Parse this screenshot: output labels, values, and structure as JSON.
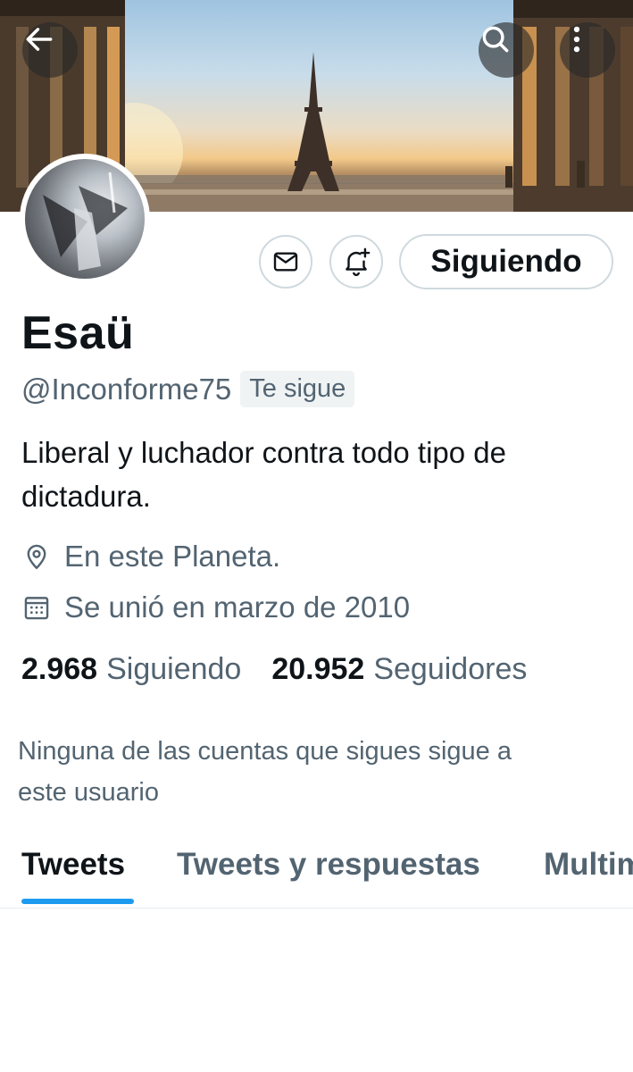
{
  "header": {
    "back_icon": "arrow-left-icon",
    "search_icon": "search-icon",
    "more_icon": "more-vertical-icon"
  },
  "profile": {
    "name": "Esaü",
    "handle": "@Inconforme75",
    "follows_you": "Te sigue",
    "bio_line1": "Liberal y luchador contra todo tipo de",
    "bio_line2": "dictadura.",
    "location": "En este Planeta.",
    "joined": "Se unió en marzo de 2010",
    "following_count": "2.968",
    "following_label": "Siguiendo",
    "followers_count": "20.952",
    "followers_label": "Seguidores",
    "mutual_line1": "Ninguna de las cuentas que sigues sigue a",
    "mutual_line2": "este usuario"
  },
  "actions": {
    "message_icon": "envelope-icon",
    "notify_icon": "bell-plus-icon",
    "follow_button": "Siguiendo"
  },
  "tabs": [
    {
      "label": "Tweets",
      "active": true
    },
    {
      "label": "Tweets y respuestas",
      "active": false
    },
    {
      "label": "Multimedia",
      "active": false
    }
  ],
  "colors": {
    "accent": "#1d9bf0",
    "text_primary": "#0f1419",
    "text_secondary": "#536471"
  }
}
